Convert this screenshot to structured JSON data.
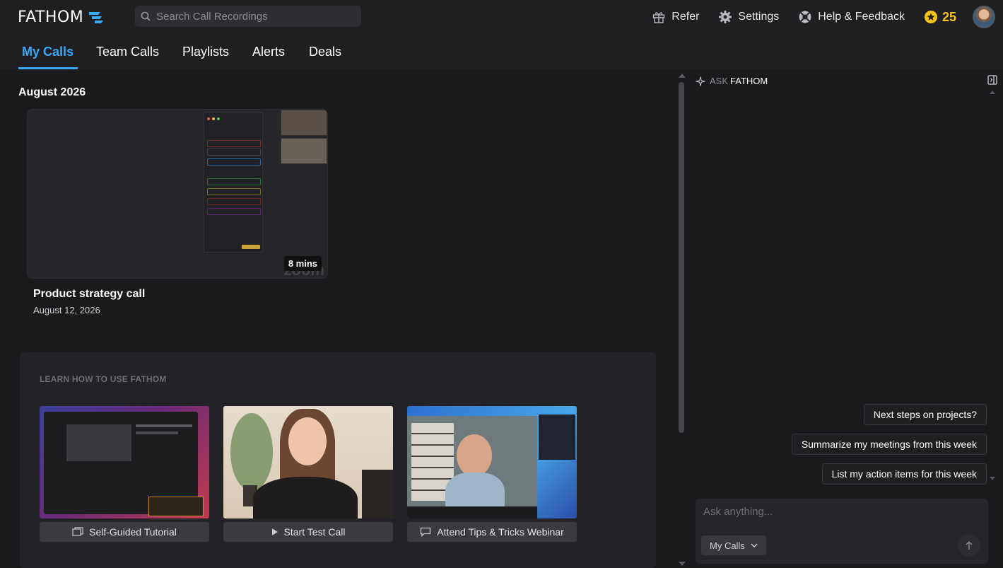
{
  "app": {
    "name": "FATHOM",
    "brand_color": "#3aa8f2",
    "logo_icon": "fathom-logo-icon"
  },
  "search": {
    "placeholder": "Search Call Recordings",
    "icon": "search-icon"
  },
  "top_nav": {
    "refer_label": "Refer",
    "settings_label": "Settings",
    "help_label": "Help & Feedback",
    "credits": "25",
    "credits_color": "#f5c518"
  },
  "tabs": [
    {
      "label": "My Calls",
      "active": true
    },
    {
      "label": "Team Calls",
      "active": false
    },
    {
      "label": "Playlists",
      "active": false
    },
    {
      "label": "Alerts",
      "active": false
    },
    {
      "label": "Deals",
      "active": false
    }
  ],
  "main": {
    "month_heading": "August 2026",
    "calls": [
      {
        "title": "Product strategy call",
        "date": "August 12, 2026",
        "duration": "8 mins"
      }
    ],
    "learn": {
      "heading": "LEARN HOW TO USE FATHOM",
      "cards": [
        {
          "label": "Self-Guided Tutorial",
          "icon": "tutorial-icon"
        },
        {
          "label": "Start Test Call",
          "icon": "play-icon"
        },
        {
          "label": "Attend Tips & Tricks Webinar",
          "icon": "chat-icon"
        }
      ]
    }
  },
  "ask_panel": {
    "title_prefix": "ASK",
    "title_brand": "FATHOM",
    "suggestions": [
      "Next steps on projects?",
      "Summarize my meetings from this week",
      "List my action items for this week"
    ],
    "input_placeholder": "Ask anything...",
    "scope_label": "My Calls"
  }
}
